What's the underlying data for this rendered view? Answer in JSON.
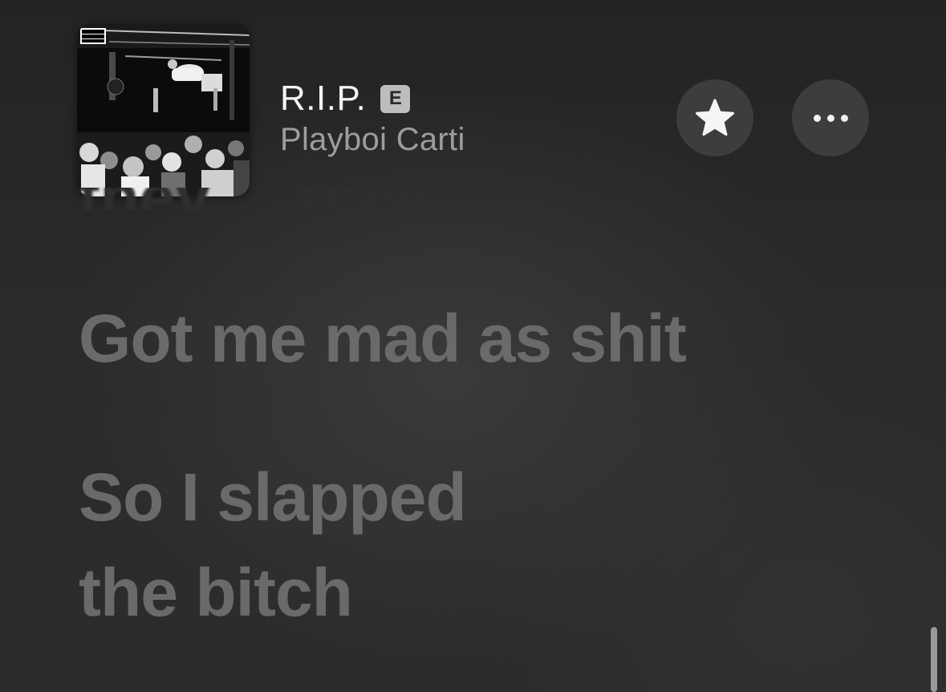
{
  "now_playing": {
    "title": "R.I.P.",
    "explicit_badge": "E",
    "artist": "Playboi Carti",
    "artwork_advisory": "PARENTAL ADVISORY EXPLICIT CONTENT"
  },
  "actions": {
    "favorite_icon": "star-icon",
    "more_icon": "ellipsis-icon"
  },
  "lyrics": {
    "previous_line": "they ... they ...",
    "lines": [
      "Got me mad as shit",
      "So I slapped",
      "the bitch"
    ]
  },
  "colors": {
    "background": "#2a2a2a",
    "lyric_inactive": "#6a6a6a",
    "title": "#f4f4f4",
    "artist": "#9d9d9d",
    "button_bg": "#3d3d3d"
  }
}
